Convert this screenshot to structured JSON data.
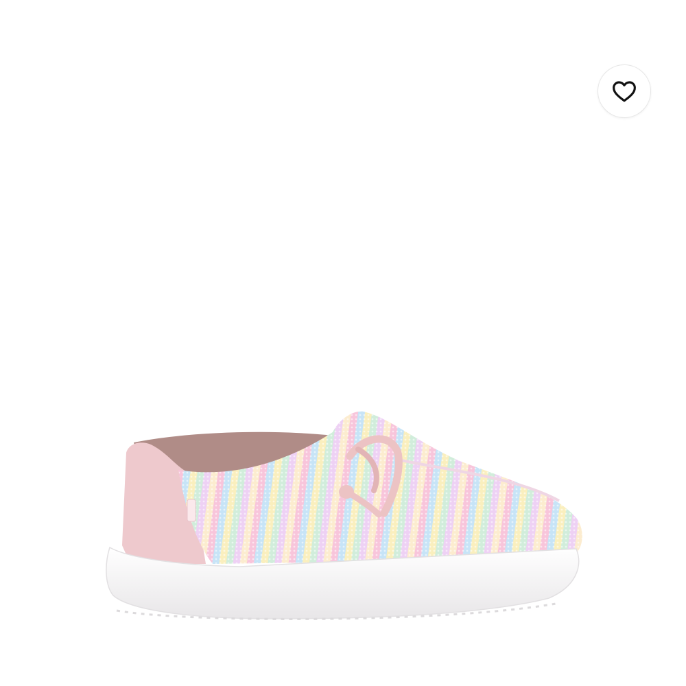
{
  "wishlist": {
    "icon": "heart-outline-icon",
    "color": "#111111"
  },
  "product_image": {
    "description_icon": "shoe-image",
    "colors": {
      "sole": "#f4f3f4",
      "heel_pink": "#eec9cd",
      "lining": "#b08c87",
      "lace": "#ecc3c4",
      "stripes": [
        "#f4a6c7",
        "#a9d6f2",
        "#f7e79b",
        "#b8e4c8",
        "#e5b8ee",
        "#fbe2b6"
      ]
    }
  }
}
